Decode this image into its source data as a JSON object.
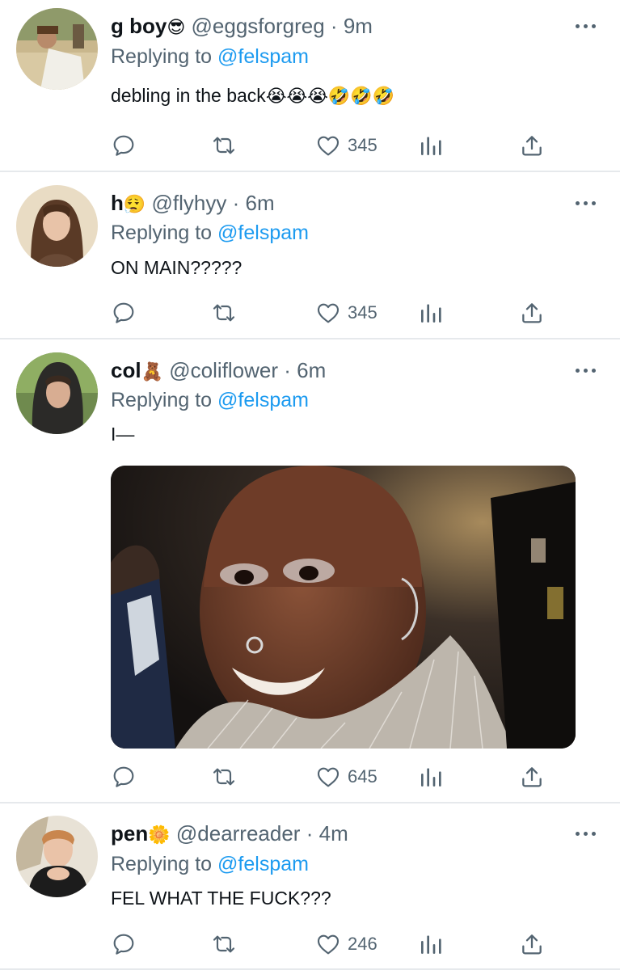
{
  "tweets": [
    {
      "name": "g boy",
      "name_emoji": "😎",
      "handle": "@eggsforgreg",
      "time": "9m",
      "replying_prefix": "Replying to",
      "replying_to": "@felspam",
      "text": "debling in the back",
      "text_emoji": "😭😭😭🤣🤣🤣",
      "likes": "345"
    },
    {
      "name": "h",
      "name_emoji": "😮‍💨",
      "handle": "@flyhyy",
      "time": "6m",
      "replying_prefix": "Replying to",
      "replying_to": "@felspam",
      "text": "ON MAIN?????",
      "likes": "345"
    },
    {
      "name": "col",
      "name_emoji": "🧸",
      "handle": "@coliflower",
      "time": "6m",
      "replying_prefix": "Replying to",
      "replying_to": "@felspam",
      "text": "I—",
      "likes": "645"
    },
    {
      "name": "pen",
      "name_emoji": "🌼",
      "handle": "@dearreader",
      "time": "4m",
      "replying_prefix": "Replying to",
      "replying_to": "@felspam",
      "text": "FEL WHAT THE FUCK???",
      "likes": "246"
    }
  ],
  "separator": "·",
  "icons": [
    "reply-icon",
    "retweet-icon",
    "like-icon",
    "analytics-icon",
    "share-icon",
    "more-icon"
  ],
  "colors": {
    "link": "#1d9bf0",
    "secondary": "#536471",
    "text": "#0f1419",
    "divider": "#e6e9ec"
  }
}
